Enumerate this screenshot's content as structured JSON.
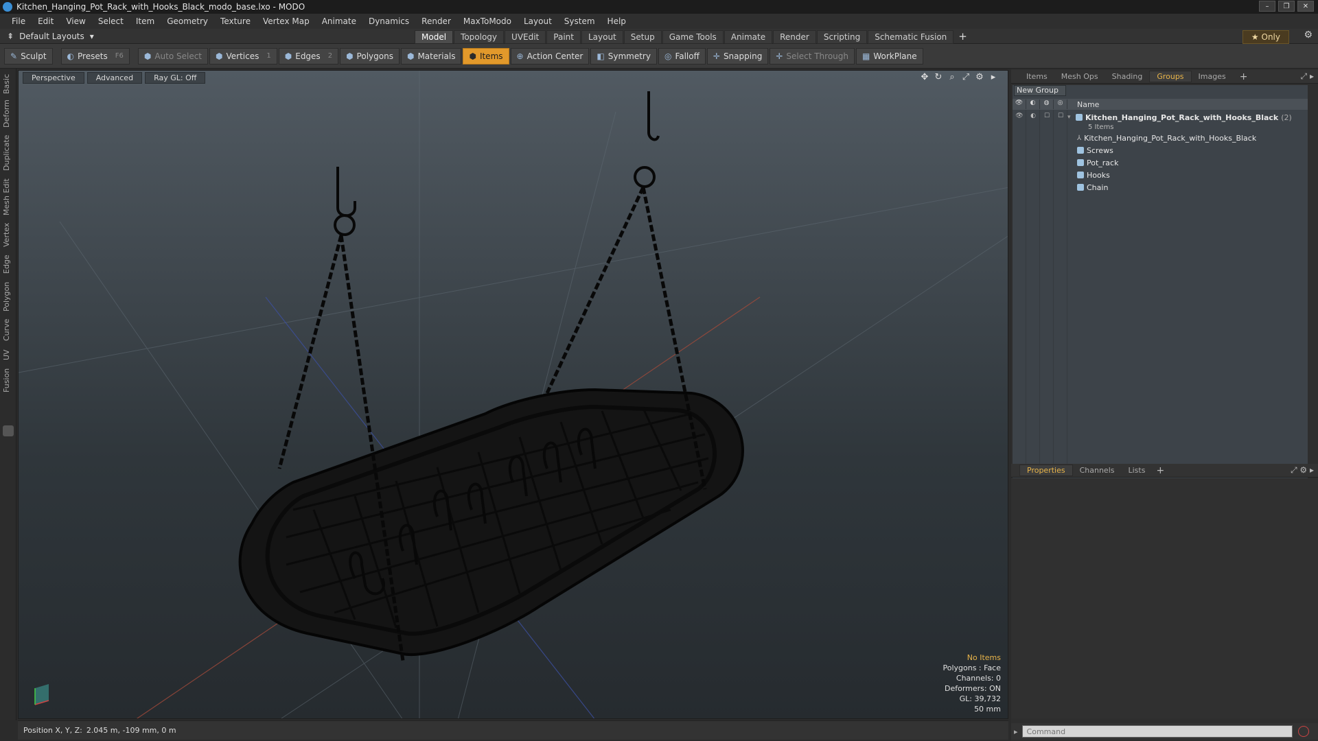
{
  "window": {
    "title": "Kitchen_Hanging_Pot_Rack_with_Hooks_Black_modo_base.lxo - MODO"
  },
  "menu": [
    "File",
    "Edit",
    "View",
    "Select",
    "Item",
    "Geometry",
    "Texture",
    "Vertex Map",
    "Animate",
    "Dynamics",
    "Render",
    "MaxToModo",
    "Layout",
    "System",
    "Help"
  ],
  "layout": {
    "preset": "Default Layouts",
    "tabs": [
      "Model",
      "Topology",
      "UVEdit",
      "Paint",
      "Layout",
      "Setup",
      "Game Tools",
      "Animate",
      "Render",
      "Scripting",
      "Schematic Fusion"
    ],
    "active_tab": "Model",
    "only_label": "Only"
  },
  "toolbar": {
    "sculpt": "Sculpt",
    "presets": "Presets",
    "presets_key": "F6",
    "auto_select": "Auto Select",
    "vertices": "Vertices",
    "vertices_count": "1",
    "edges": "Edges",
    "edges_count": "2",
    "polygons": "Polygons",
    "materials": "Materials",
    "items": "Items",
    "action_center": "Action Center",
    "symmetry": "Symmetry",
    "falloff": "Falloff",
    "snapping": "Snapping",
    "select_through": "Select Through",
    "workplane": "WorkPlane"
  },
  "left_tabs": [
    "Basic",
    "Deform",
    "Duplicate",
    "Mesh Edit",
    "Vertex",
    "Edge",
    "Polygon",
    "Curve",
    "UV",
    "Fusion"
  ],
  "viewport": {
    "view": "Perspective",
    "shading": "Advanced",
    "raygl": "Ray GL: Off",
    "info": {
      "selection": "No Items",
      "polygons": "Polygons : Face",
      "channels": "Channels: 0",
      "deformers": "Deformers: ON",
      "gl": "GL: 39,732",
      "grid": "50 mm"
    }
  },
  "status": {
    "label": "Position X, Y, Z:",
    "value": "2.045 m, -109 mm, 0 m"
  },
  "right_panel": {
    "tabs": [
      "Items",
      "Mesh Ops",
      "Shading",
      "Groups",
      "Images"
    ],
    "active_tab": "Groups",
    "new_group": "New Group",
    "name_header": "Name",
    "root": {
      "name": "Kitchen_Hanging_Pot_Rack_with_Hooks_Black",
      "count": "(2)",
      "sub": "5 Items"
    },
    "children": [
      "Kitchen_Hanging_Pot_Rack_with_Hooks_Black",
      "Screws",
      "Pot_rack",
      "Hooks",
      "Chain"
    ]
  },
  "properties": {
    "tabs": [
      "Properties",
      "Channels",
      "Lists"
    ],
    "active_tab": "Properties"
  },
  "command": {
    "placeholder": "Command"
  },
  "colors": {
    "accent": "#e2992b",
    "info_highlight": "#e9b54a"
  }
}
